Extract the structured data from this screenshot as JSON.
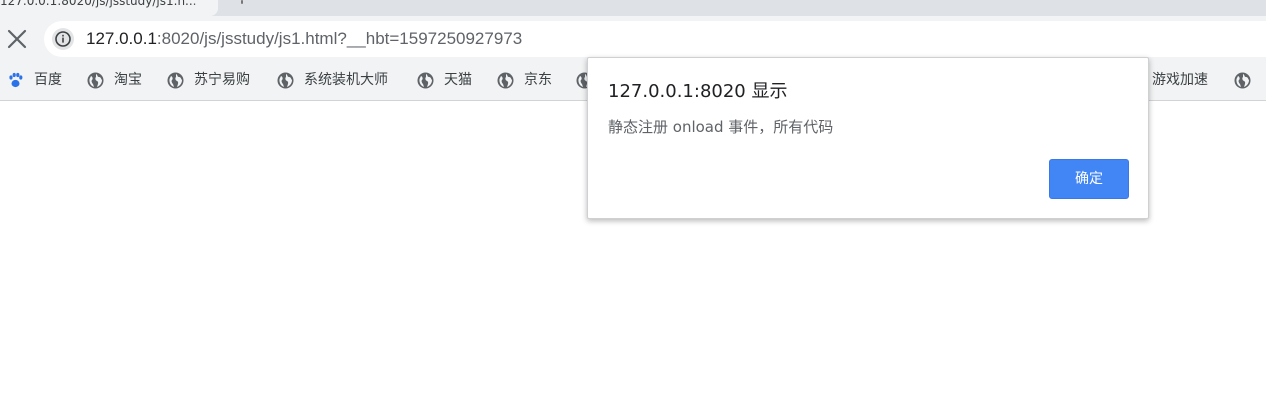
{
  "tab": {
    "title": "127.0.0.1:8020/js/jsstudy/js1.h..."
  },
  "omnibox": {
    "host": "127.0.0.1",
    "rest": ":8020/js/jsstudy/js1.html?__hbt=1597250927973"
  },
  "bookmarks": [
    {
      "label": "百度",
      "icon": "baidu-paw-icon"
    },
    {
      "label": "淘宝",
      "icon": "globe-icon"
    },
    {
      "label": "苏宁易购",
      "icon": "globe-icon"
    },
    {
      "label": "系统装机大师",
      "icon": "globe-icon"
    },
    {
      "label": "天猫",
      "icon": "globe-icon"
    },
    {
      "label": "京东",
      "icon": "globe-icon"
    },
    {
      "label": "游戏加速",
      "icon": "none"
    },
    {
      "label": "",
      "icon": "globe-icon"
    }
  ],
  "dialog": {
    "title": "127.0.0.1:8020 显示",
    "message": "静态注册 onload 事件，所有代码",
    "ok_label": "确定"
  },
  "colors": {
    "accent": "#4285f4",
    "toolbar": "#f1f3f4",
    "tabstrip": "#dee1e6"
  }
}
